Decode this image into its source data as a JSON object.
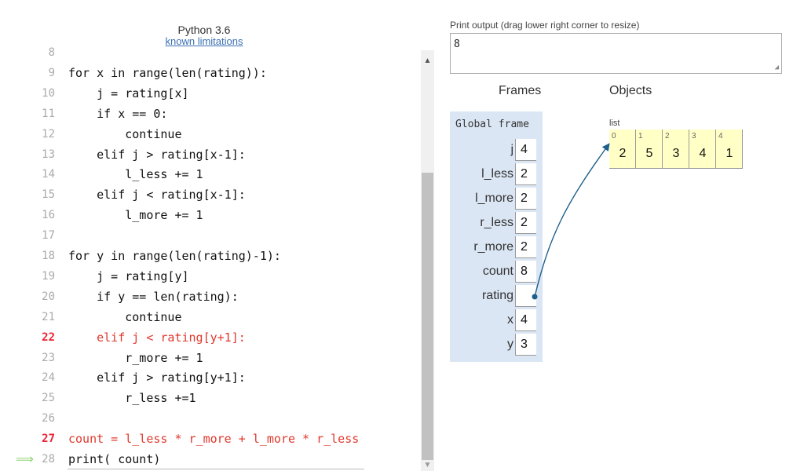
{
  "header": {
    "title": "Python 3.6",
    "link": "known limitations"
  },
  "code": {
    "lines": [
      {
        "no": "8",
        "text": ""
      },
      {
        "no": "9",
        "text": "for x in range(len(rating)):"
      },
      {
        "no": "10",
        "text": "    j = rating[x]"
      },
      {
        "no": "11",
        "text": "    if x == 0:"
      },
      {
        "no": "12",
        "text": "        continue"
      },
      {
        "no": "13",
        "text": "    elif j > rating[x-1]:"
      },
      {
        "no": "14",
        "text": "        l_less += 1"
      },
      {
        "no": "15",
        "text": "    elif j < rating[x-1]:"
      },
      {
        "no": "16",
        "text": "        l_more += 1"
      },
      {
        "no": "17",
        "text": ""
      },
      {
        "no": "18",
        "text": "for y in range(len(rating)-1):"
      },
      {
        "no": "19",
        "text": "    j = rating[y]"
      },
      {
        "no": "20",
        "text": "    if y == len(rating):"
      },
      {
        "no": "21",
        "text": "        continue"
      },
      {
        "no": "22",
        "text": "    elif j < rating[y+1]:"
      },
      {
        "no": "23",
        "text": "        r_more += 1"
      },
      {
        "no": "24",
        "text": "    elif j > rating[y+1]:"
      },
      {
        "no": "25",
        "text": "        r_less +=1"
      },
      {
        "no": "26",
        "text": ""
      },
      {
        "no": "27",
        "text": "count = l_less * r_more + l_more * r_less"
      },
      {
        "no": "28",
        "text": "print( count)"
      }
    ],
    "error_lines": [
      "22",
      "27"
    ],
    "current_line": "28",
    "arrow_glyph": "⟹"
  },
  "print_output": {
    "label": "Print output (drag lower right corner to resize)",
    "value": "8"
  },
  "frames": {
    "label": "Frames",
    "global_title": "Global frame",
    "vars": [
      {
        "name": "j",
        "value": "4"
      },
      {
        "name": "l_less",
        "value": "2"
      },
      {
        "name": "l_more",
        "value": "2"
      },
      {
        "name": "r_less",
        "value": "2"
      },
      {
        "name": "r_more",
        "value": "2"
      },
      {
        "name": "count",
        "value": "8"
      },
      {
        "name": "rating",
        "value": ""
      },
      {
        "name": "x",
        "value": "4"
      },
      {
        "name": "y",
        "value": "3"
      }
    ]
  },
  "objects": {
    "label": "Objects",
    "list_label": "list",
    "list": [
      {
        "index": "0",
        "value": "2"
      },
      {
        "index": "1",
        "value": "5"
      },
      {
        "index": "2",
        "value": "3"
      },
      {
        "index": "3",
        "value": "4"
      },
      {
        "index": "4",
        "value": "1"
      }
    ]
  },
  "colors": {
    "error": "#e0392e",
    "frame_bg": "#dbe6f4",
    "list_bg": "#ffffc6",
    "pointer": "#1f5f8b",
    "arrow": "#8fd26e"
  }
}
